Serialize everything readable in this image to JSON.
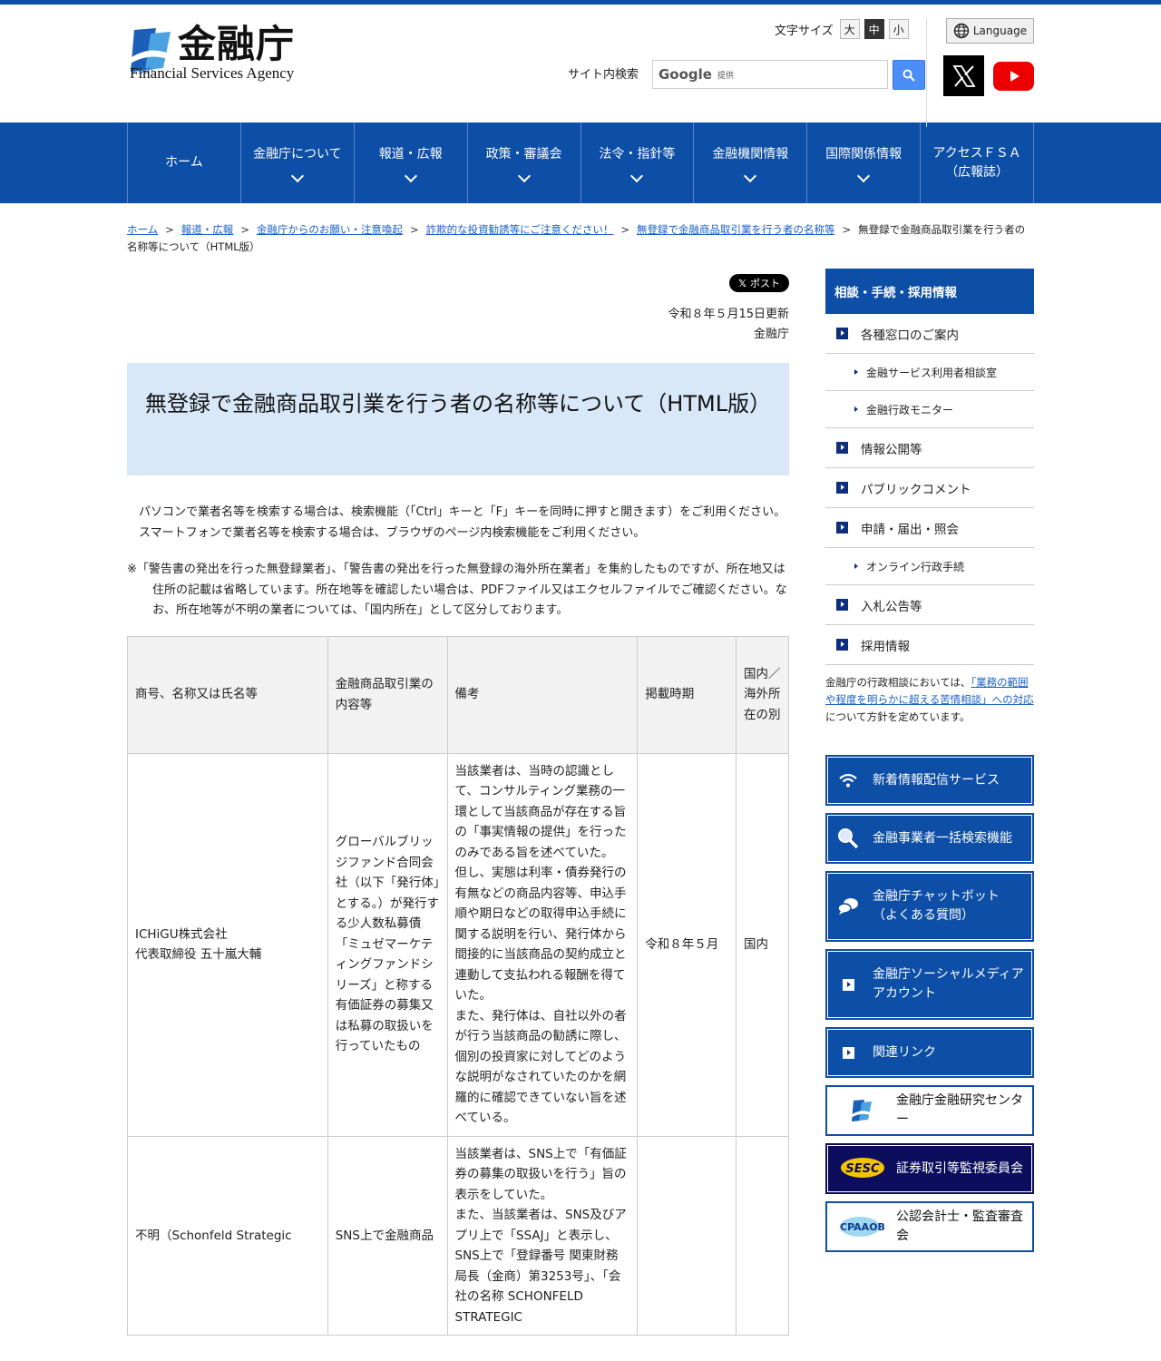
{
  "header": {
    "logo_jp": "金融庁",
    "logo_en": "Financial Services Agency",
    "font_size_label": "文字サイズ",
    "font_sizes": [
      "大",
      "中",
      "小"
    ],
    "language_label": "Language",
    "search_label": "サイト内検索",
    "search_google": "Google",
    "search_provided": "提供"
  },
  "nav": {
    "items": [
      {
        "label": "ホーム"
      },
      {
        "label": "金融庁について"
      },
      {
        "label": "報道・広報"
      },
      {
        "label": "政策・審議会"
      },
      {
        "label": "法令・指針等"
      },
      {
        "label": "金融機関情報"
      },
      {
        "label": "国際関係情報"
      },
      {
        "label": "アクセスＦＳＡ\n（広報誌）"
      }
    ]
  },
  "breadcrumb": {
    "items": [
      "ホーム",
      "報道・広報",
      "金融庁からのお願い・注意喚起",
      "詐欺的な投資勧誘等にご注意ください！",
      "無登録で金融商品取引業を行う者の名称等"
    ],
    "current": "無登録で金融商品取引業を行う者の名称等について（HTML版）",
    "separator": ">"
  },
  "main": {
    "post_label": "ポスト",
    "updated": "令和８年５月15日更新",
    "agency": "金融庁",
    "title": "無登録で金融商品取引業を行う者の名称等について（HTML版）",
    "intro1": "パソコンで業者名等を検索する場合は、検索機能（「Ctrl」キーと「F」キーを同時に押すと開きます）をご利用ください。",
    "intro2": "スマートフォンで業者名等を検索する場合は、ブラウザのページ内検索機能をご利用ください。",
    "note": "※「警告書の発出を行った無登録業者」、「警告書の発出を行った無登録の海外所在業者」を集約したものですが、所在地又は住所の記載は省略しています。所在地等を確認したい場合は、PDFファイル又はエクセルファイルでご確認ください。なお、所在地等が不明の業者については、「国内所在」として区分しております。",
    "table": {
      "headers": [
        "商号、名称又は氏名等",
        "金融商品取引業の内容等",
        "備考",
        "掲載時期",
        "国内／海外所在の別"
      ],
      "rows": [
        {
          "name_line1": "ICHiGU株式会社",
          "name_line2": "代表取締役 五十嵐大輔",
          "content": "グローバルブリッジファンド合同会社（以下「発行体」とする。）が発行する少人数私募債「ミュゼマーケティングファンドシリーズ」と称する有価証券の募集又は私募の取扱いを行っていたもの",
          "remarks1": "当該業者は、当時の認識として、コンサルティング業務の一環として当該商品が存在する旨の「事実情報の提供」を行ったのみである旨を述べていた。",
          "remarks2": "但し、実態は利率・債券発行の有無などの商品内容等、申込手順や期日などの取得申込手続に関する説明を行い、発行体から間接的に当該商品の契約成立と連動して支払われる報酬を得ていた。",
          "remarks3": "また、発行体は、自社以外の者が行う当該商品の勧誘に際し、個別の投資家に対してどのような説明がなされていたのかを網羅的に確認できていない旨を述べている。",
          "period": "令和８年５月",
          "location": "国内"
        },
        {
          "name_line1": "不明（Schonfeld Strategic",
          "name_line2": "",
          "content": "SNS上で金融商品",
          "remarks1": "当該業者は、SNS上で「有価証券の募集の取扱いを行う」旨の表示をしていた。",
          "remarks2": "また、当該業者は、SNS及びアプリ上で「SSAJ」と表示し、SNS上で「登録番号 関東財務局長（金商）第3253号」、「会社の名称 SCHONFELD STRATEGIC",
          "remarks3": "",
          "period": "",
          "location": ""
        }
      ]
    }
  },
  "side": {
    "head": "相談・手続・採用情報",
    "menu": {
      "i1": "各種窓口のご案内",
      "s1": "金融サービス利用者相談室",
      "s2": "金融行政モニター",
      "i2": "情報公開等",
      "i3": "パブリックコメント",
      "i4": "申請・届出・照会",
      "s3": "オンライン行政手続",
      "i5": "入札公告等",
      "i6": "採用情報"
    },
    "note_pre": "金融庁の行政相談においては、",
    "note_link": "「業務の範囲や程度を明らかに超える苦情相談」への対応",
    "note_post": "について方針を定めています。",
    "banners": {
      "b1": "新着情報配信サービス",
      "b2": "金融事業者一括検索機能",
      "b3a": "金融庁チャットボット",
      "b3b": "（よくある質問）",
      "b4a": "金融庁ソーシャルメディア",
      "b4b": "アカウント",
      "b5": "関連リンク",
      "b6": "金融庁金融研究センター",
      "b7": "証券取引等監視委員会",
      "b8": "公認会計士・監査審査会"
    }
  }
}
